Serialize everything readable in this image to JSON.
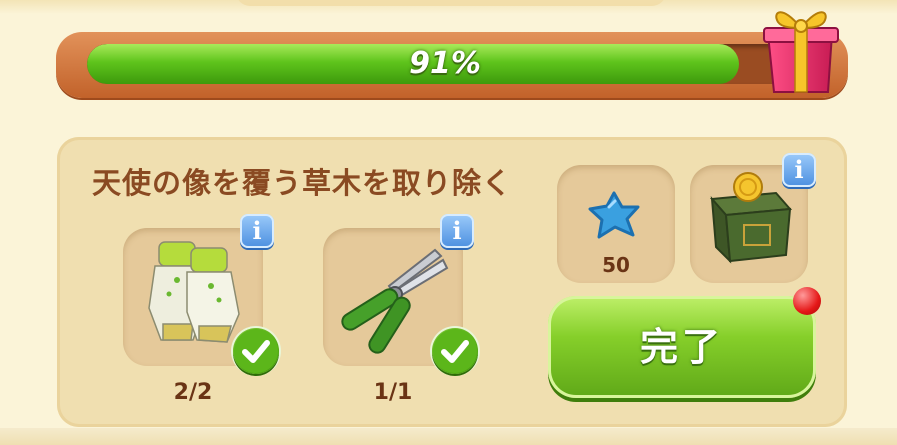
{
  "progress": {
    "percent_label": "91%",
    "fraction": 0.91,
    "fill_color": "#5fc41c",
    "reward_icon": "gift-box-icon"
  },
  "task": {
    "title": "天使の像を覆う草木を取り除く",
    "requirements": [
      {
        "icon": "gardening-gloves-icon",
        "count": "2/2",
        "completed": true
      },
      {
        "icon": "pruning-shears-icon",
        "count": "1/1",
        "completed": true
      }
    ],
    "rewards": [
      {
        "icon": "blue-star-icon",
        "amount": "50"
      },
      {
        "icon": "coin-chest-icon"
      }
    ],
    "complete_button": {
      "label": "完了",
      "notification": true
    }
  },
  "colors": {
    "accent_green": "#86cf2a",
    "frame_orange": "#d37a40",
    "title_brown": "#8a4a22",
    "info_blue": "#4b8fe0",
    "notification_red": "#e51818"
  }
}
